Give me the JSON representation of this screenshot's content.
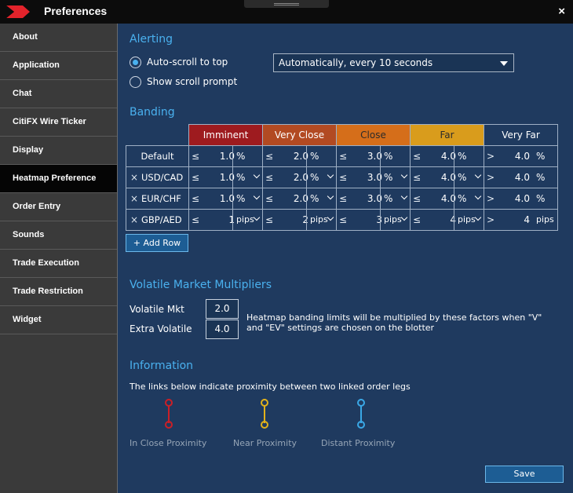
{
  "window": {
    "title": "Preferences",
    "close_glyph": "×",
    "logo_icon": "citi-red-chevron-logo",
    "accent_color": "#4ab1ef"
  },
  "sidebar": {
    "items": [
      {
        "label": "About",
        "active": false
      },
      {
        "label": "Application",
        "active": false
      },
      {
        "label": "Chat",
        "active": false
      },
      {
        "label": "CitiFX Wire Ticker",
        "active": false
      },
      {
        "label": "Display",
        "active": false
      },
      {
        "label": "Heatmap Preference",
        "active": true
      },
      {
        "label": "Order Entry",
        "active": false
      },
      {
        "label": "Sounds",
        "active": false
      },
      {
        "label": "Trade Execution",
        "active": false
      },
      {
        "label": "Trade Restriction",
        "active": false
      },
      {
        "label": "Widget",
        "active": false
      }
    ]
  },
  "alerting": {
    "title": "Alerting",
    "auto_scroll_label": "Auto-scroll to top",
    "auto_scroll_selected": true,
    "show_prompt_label": "Show scroll prompt",
    "show_prompt_selected": false,
    "interval_value": "Automatically, every 10 seconds"
  },
  "banding": {
    "title": "Banding",
    "columns": [
      {
        "label": "Imminent",
        "color": "#9e1b1f"
      },
      {
        "label": "Very Close",
        "color": "#b24a22"
      },
      {
        "label": "Close",
        "color": "#d56e1a"
      },
      {
        "label": "Far",
        "color": "#d99c1c"
      },
      {
        "label": "Very Far",
        "color": "#1f3a5f"
      }
    ],
    "lte": "≤",
    "gt": ">",
    "remove_glyph": "×",
    "rows": [
      {
        "label": "Default",
        "removable": false,
        "values": [
          "1.0",
          "2.0",
          "3.0",
          "4.0",
          "4.0"
        ],
        "units": [
          "%",
          "%",
          "%",
          "%",
          "%"
        ],
        "dropdown": false
      },
      {
        "label": "USD/CAD",
        "removable": true,
        "values": [
          "1.0",
          "2.0",
          "3.0",
          "4.0",
          "4.0"
        ],
        "units": [
          "%",
          "%",
          "%",
          "%",
          "%"
        ],
        "dropdown": true
      },
      {
        "label": "EUR/CHF",
        "removable": true,
        "values": [
          "1.0",
          "2.0",
          "3.0",
          "4.0",
          "4.0"
        ],
        "units": [
          "%",
          "%",
          "%",
          "%",
          "%"
        ],
        "dropdown": true
      },
      {
        "label": "GBP/AED",
        "removable": true,
        "values": [
          "1",
          "2",
          "3",
          "4",
          "4"
        ],
        "units": [
          "pips",
          "pips",
          "pips",
          "pips",
          "pips"
        ],
        "dropdown": true
      }
    ],
    "add_row_label": "+ Add Row"
  },
  "volatile": {
    "title": "Volatile Market Multipliers",
    "mkt_label": "Volatile Mkt",
    "mkt_value": "2.0",
    "extra_label": "Extra Volatile",
    "extra_value": "4.0",
    "note": "Heatmap banding limits will be multiplied by these factors when \"V\" and \"EV\" settings are chosen on the blotter"
  },
  "information": {
    "title": "Information",
    "text": "The links below indicate proximity between two linked order legs",
    "items": [
      {
        "label": "In Close Proximity",
        "color": "#cc1f26"
      },
      {
        "label": "Near Proximity",
        "color": "#e3b21a"
      },
      {
        "label": "Distant Proximity",
        "color": "#3aa8e6"
      }
    ]
  },
  "save_label": "Save"
}
